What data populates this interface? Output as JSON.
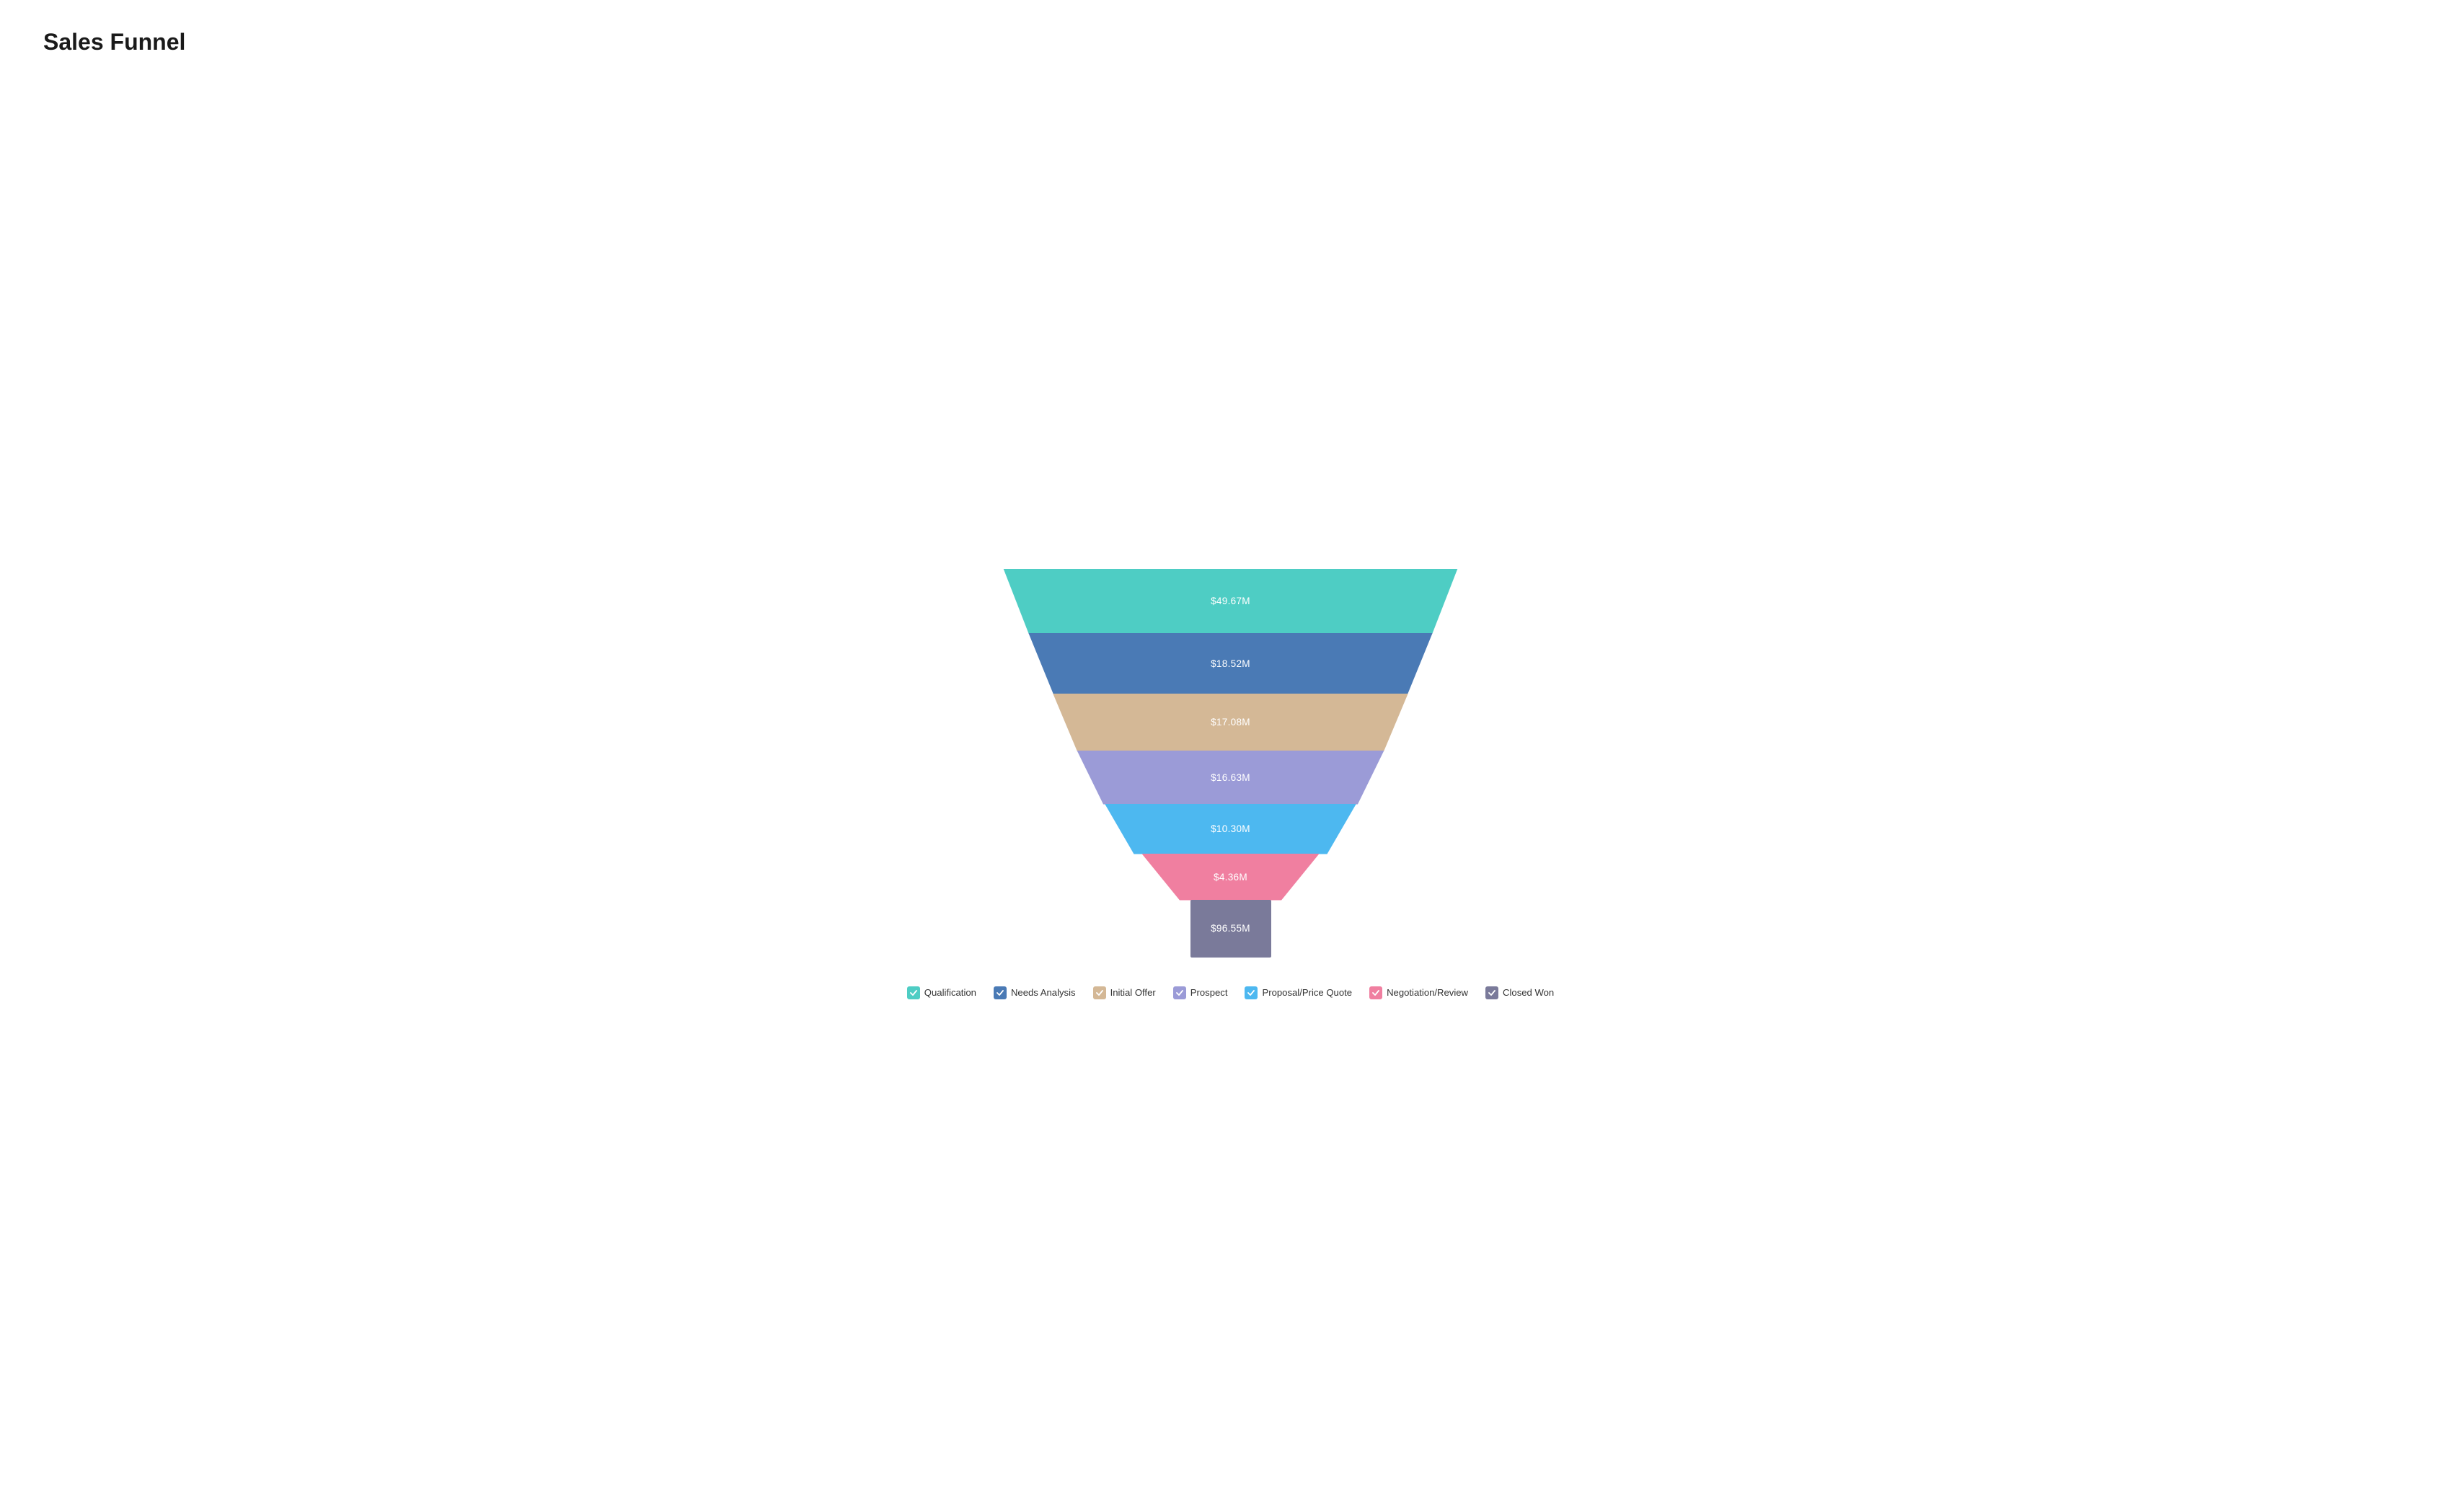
{
  "title": "Sales Funnel",
  "segments": [
    {
      "id": 0,
      "label": "Qualification",
      "value": "$49.67M",
      "color": "#4ecdc4",
      "checkColor": "#4ecdc4"
    },
    {
      "id": 1,
      "label": "Needs Analysis",
      "value": "$18.52M",
      "color": "#4a7ab5",
      "checkColor": "#4a7ab5"
    },
    {
      "id": 2,
      "label": "Initial Offer",
      "value": "$17.08M",
      "color": "#d4b896",
      "checkColor": "#d4b896"
    },
    {
      "id": 3,
      "label": "Prospect",
      "value": "$16.63M",
      "color": "#9b9bd7",
      "checkColor": "#9b9bd7"
    },
    {
      "id": 4,
      "label": "Proposal/Price Quote",
      "value": "$10.30M",
      "color": "#4db8f0",
      "checkColor": "#4db8f0"
    },
    {
      "id": 5,
      "label": "Negotiation/Review",
      "value": "$4.36M",
      "color": "#f07fa0",
      "checkColor": "#f07fa0"
    },
    {
      "id": 6,
      "label": "Closed Won",
      "value": "$96.55M",
      "color": "#7a7a9a",
      "checkColor": "#7a7a9a"
    }
  ]
}
